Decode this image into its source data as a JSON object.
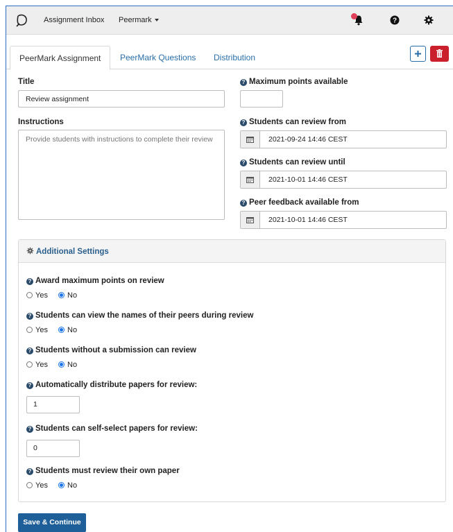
{
  "navbar": {
    "inbox_label": "Assignment Inbox",
    "peermark_label": "Peermark",
    "icons": [
      "logo-icon",
      "bell-icon",
      "help-icon",
      "gear-icon"
    ]
  },
  "tabs": [
    {
      "label": "PeerMark Assignment",
      "active": true
    },
    {
      "label": "PeerMark Questions",
      "active": false
    },
    {
      "label": "Distribution",
      "active": false
    }
  ],
  "buttons": {
    "add_symbol": "+",
    "delete_icon": "trash-icon"
  },
  "form": {
    "title_label": "Title",
    "title_value": "Review assignment",
    "instructions_label": "Instructions",
    "instructions_placeholder": "Provide students with instructions to complete their review",
    "max_points_label": "Maximum points available",
    "max_points_value": "",
    "review_from_label": "Students can review from",
    "review_from_value": "2021-09-24 14:46 CEST",
    "review_until_label": "Students can review until",
    "review_until_value": "2021-10-01 14:46 CEST",
    "feedback_from_label": "Peer feedback available from",
    "feedback_from_value": "2021-10-01 14:46 CEST"
  },
  "settings": {
    "title": "Additional Settings",
    "yes_label": "Yes",
    "no_label": "No",
    "award_label": "Award maximum points on review",
    "names_label": "Students can view the names of their peers during review",
    "no_submission_label": "Students without a submission can review",
    "auto_distribute_label": "Automatically distribute papers for review:",
    "auto_distribute_value": "1",
    "self_select_label": "Students can self-select papers for review:",
    "self_select_value": "0",
    "own_paper_label": "Students must review their own paper"
  },
  "save_label": "Save & Continue",
  "colors": {
    "primary": "#1f5f99",
    "danger": "#c9202c",
    "link": "#2a6ea7",
    "radio": "#1a73e8"
  }
}
